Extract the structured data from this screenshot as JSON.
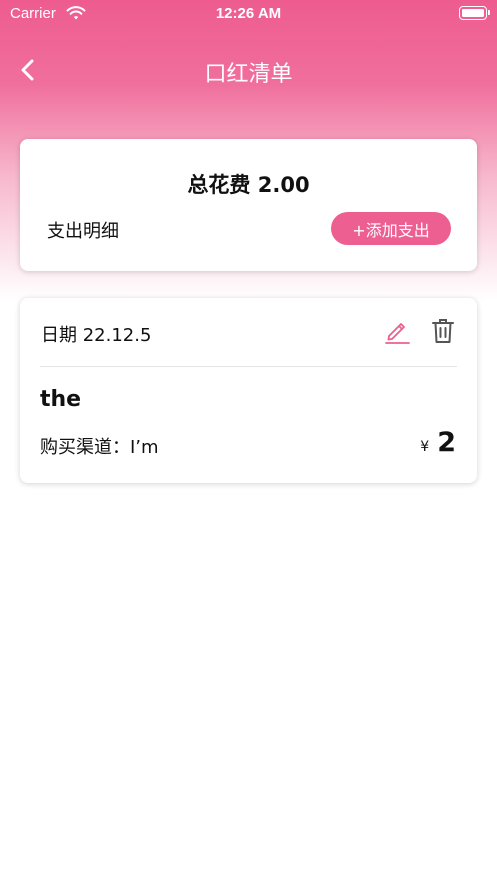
{
  "status_bar": {
    "carrier": "Carrier",
    "time": "12:26 AM"
  },
  "nav": {
    "title": "口红清单",
    "back_icon": "chevron-left-icon"
  },
  "summary": {
    "total_text": "总花费 2.00",
    "detail_label": "支出明细",
    "add_button_label": "+添加支出"
  },
  "record": {
    "date_text": "日期 22.12.5",
    "name": "the",
    "channel_text": "购买渠道：I’m",
    "currency": "¥",
    "amount": "2",
    "edit_icon": "pencil-icon",
    "delete_icon": "trash-icon"
  },
  "colors": {
    "accent": "#ee5f91",
    "header_top": "#ee5c8f"
  }
}
